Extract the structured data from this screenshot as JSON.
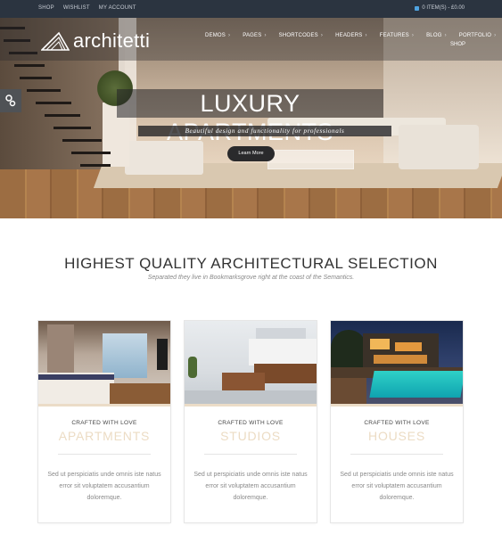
{
  "topbar": {
    "links": [
      "SHOP",
      "WISHLIST",
      "MY ACCOUNT"
    ],
    "cart": "0 ITEM(S) - £0.00",
    "cart_icon": "shopping-bag-icon"
  },
  "brand": {
    "name": "architetti",
    "logo_icon": "triangle-roof-logo-icon"
  },
  "nav": {
    "items": [
      {
        "label": "DEMOS"
      },
      {
        "label": "PAGES"
      },
      {
        "label": "SHORTCODES"
      },
      {
        "label": "HEADERS"
      },
      {
        "label": "FEATURES"
      },
      {
        "label": "BLOG"
      },
      {
        "label": "PORTFOLIO"
      }
    ],
    "second_row": "SHOP",
    "chevron_icon": "chevron-right-icon"
  },
  "side_tab": {
    "icon": "gears-icon"
  },
  "hero": {
    "title": "LUXURY APARTMENTS",
    "subtitle": "Beautiful design and functionality for professionals",
    "button": "Learn More"
  },
  "section": {
    "title": "HIGHEST QUALITY ARCHITECTURAL SELECTION",
    "subtitle": "Separated they live in Bookmarksgrove right at the coast of the Semantics."
  },
  "cards": [
    {
      "kicker": "CRAFTED WITH LOVE",
      "title": "APARTMENTS",
      "body": "Sed ut perspiciatis unde omnis iste natus error sit voluptatem accusantium doloremque."
    },
    {
      "kicker": "CRAFTED WITH LOVE",
      "title": "STUDIOS",
      "body": "Sed ut perspiciatis unde omnis iste natus error sit voluptatem accusantium doloremque."
    },
    {
      "kicker": "CRAFTED WITH LOVE",
      "title": "HOUSES",
      "body": "Sed ut perspiciatis unde omnis iste natus error sit voluptatem accusantium doloremque."
    }
  ],
  "colors": {
    "topbar": "#2b3440",
    "accent_beige": "#ecdcc4",
    "cart_icon": "#4fa3e0"
  }
}
